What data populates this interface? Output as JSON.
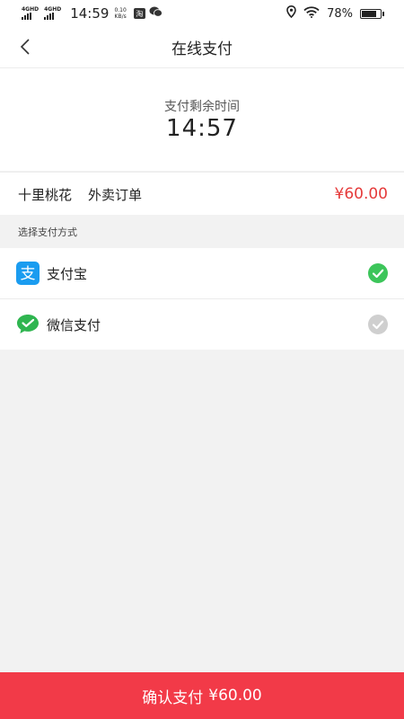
{
  "status_bar": {
    "network_label_1": "4GHD",
    "network_label_2": "4GHD",
    "time": "14:59",
    "speed_value": "0.10",
    "speed_unit": "KB/s",
    "app_icon_char": "淘",
    "battery_percent": "78%",
    "battery_level": 0.78
  },
  "navbar": {
    "title": "在线支付"
  },
  "timer": {
    "label": "支付剩余时间",
    "value": "14:57"
  },
  "order": {
    "shop_name": "十里桃花",
    "order_type": "外卖订单",
    "price": "¥60.00"
  },
  "section": {
    "header": "选择支付方式"
  },
  "payment_methods": [
    {
      "label": "支付宝",
      "icon": "alipay-icon",
      "selected": true
    },
    {
      "label": "微信支付",
      "icon": "wechat-pay-icon",
      "selected": false
    }
  ],
  "footer": {
    "confirm_label": "确认支付",
    "amount": "¥60.00"
  },
  "colors": {
    "accent": "#f23a48",
    "price": "#e53a3a",
    "alipay": "#1a9cf0",
    "wechat": "#2fb550",
    "check_selected": "#3cc55a",
    "check_unselected": "#cfcfcf"
  }
}
